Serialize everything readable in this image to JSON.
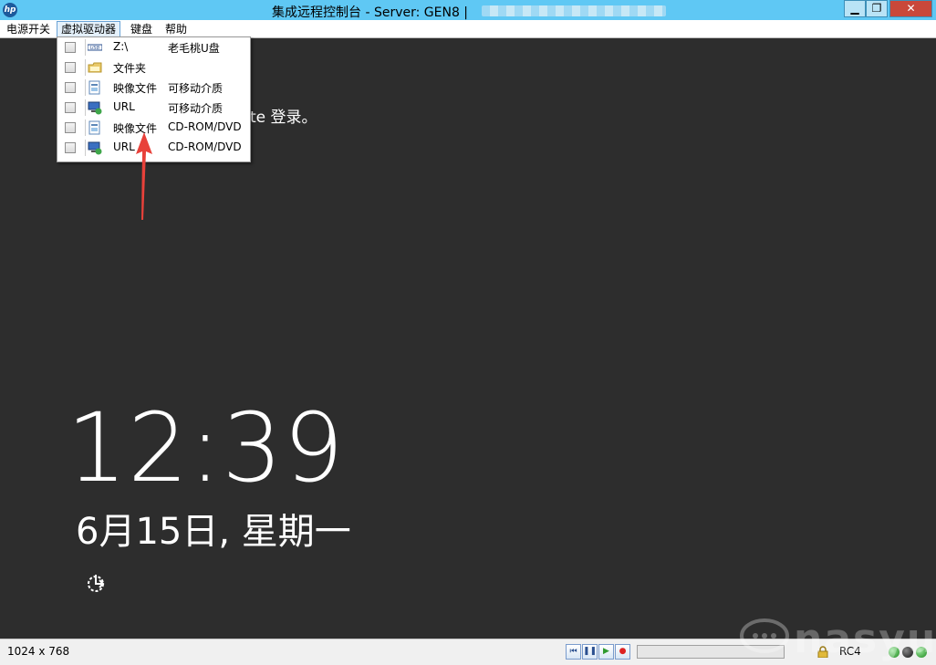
{
  "window": {
    "title": "集成远程控制台 - Server: GEN8 |",
    "logo_text": "hp",
    "buttons": [
      "minimize",
      "restore",
      "close"
    ]
  },
  "menubar": {
    "items": [
      {
        "label": "电源开关"
      },
      {
        "label": "虚拟驱动器",
        "active": true
      },
      {
        "label": "键盘"
      },
      {
        "label": "帮助"
      }
    ]
  },
  "virtual_drives": {
    "items": [
      {
        "name": "Z:\\",
        "type": "老毛桃U盘",
        "icon": "usb-drive-icon",
        "checked": false
      },
      {
        "name": "文件夹",
        "type": "",
        "icon": "folder-icon",
        "checked": false
      },
      {
        "name": "映像文件",
        "type": "可移动介质",
        "icon": "image-file-icon",
        "checked": false
      },
      {
        "name": "URL",
        "type": "可移动介质",
        "icon": "network-url-icon",
        "checked": false
      },
      {
        "name": "映像文件",
        "type": "CD-ROM/DVD",
        "icon": "image-file-icon",
        "checked": false
      },
      {
        "name": "URL",
        "type": "CD-ROM/DVD",
        "icon": "network-url-icon",
        "checked": false
      }
    ]
  },
  "remote_screen": {
    "login_hint": "te 登录。",
    "time": "12:39",
    "date": "6月15日, 星期一"
  },
  "statusbar": {
    "resolution": "1024 x 768",
    "encryption": "RC4",
    "playback_buttons": [
      "skip-back",
      "pause",
      "play",
      "record"
    ],
    "progress": 0
  },
  "watermark": {
    "text": "nasyun"
  },
  "colors": {
    "titlebar": "#5fc8f4",
    "screen_bg": "#2d2d2d",
    "close_button": "#c9483a",
    "annotation_arrow": "#e8413a"
  }
}
